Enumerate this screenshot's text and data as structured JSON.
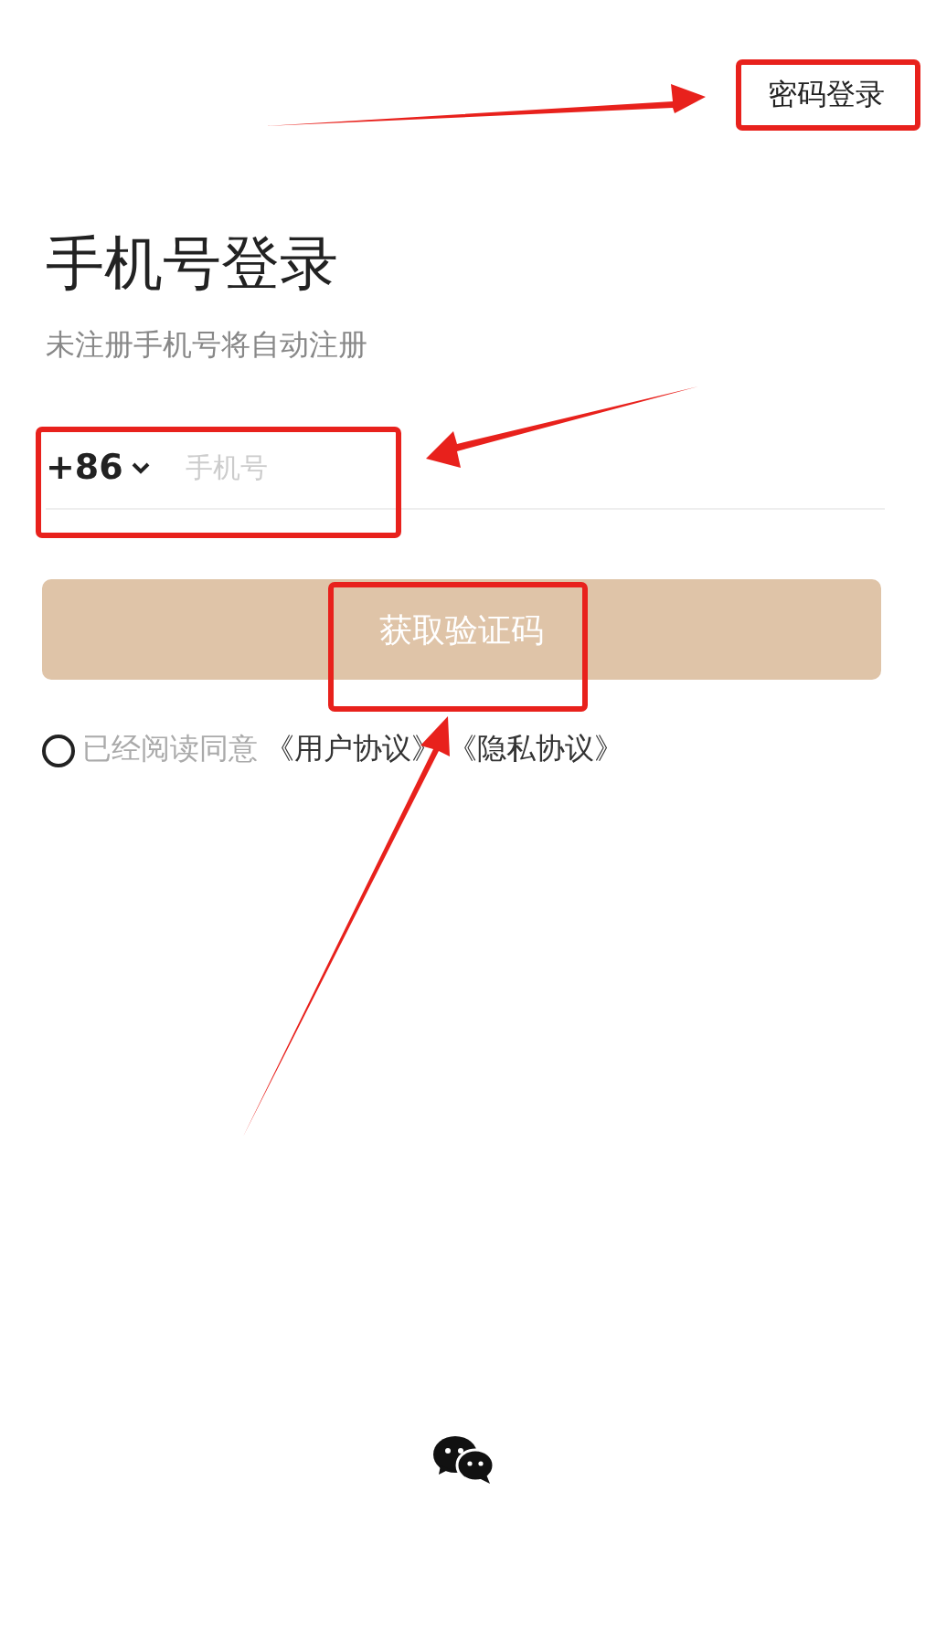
{
  "top_link": "密码登录",
  "title": "手机号登录",
  "subtitle": "未注册手机号将自动注册",
  "phone": {
    "country_code": "+86",
    "placeholder": "手机号"
  },
  "submit_button": {
    "label": "获取验证码",
    "disabled": true
  },
  "agreement": {
    "checked": false,
    "text": "已经阅读同意",
    "links": [
      "《用户协议》",
      "《隐私协议》"
    ]
  },
  "social_login": {
    "kind": "wechat"
  }
}
